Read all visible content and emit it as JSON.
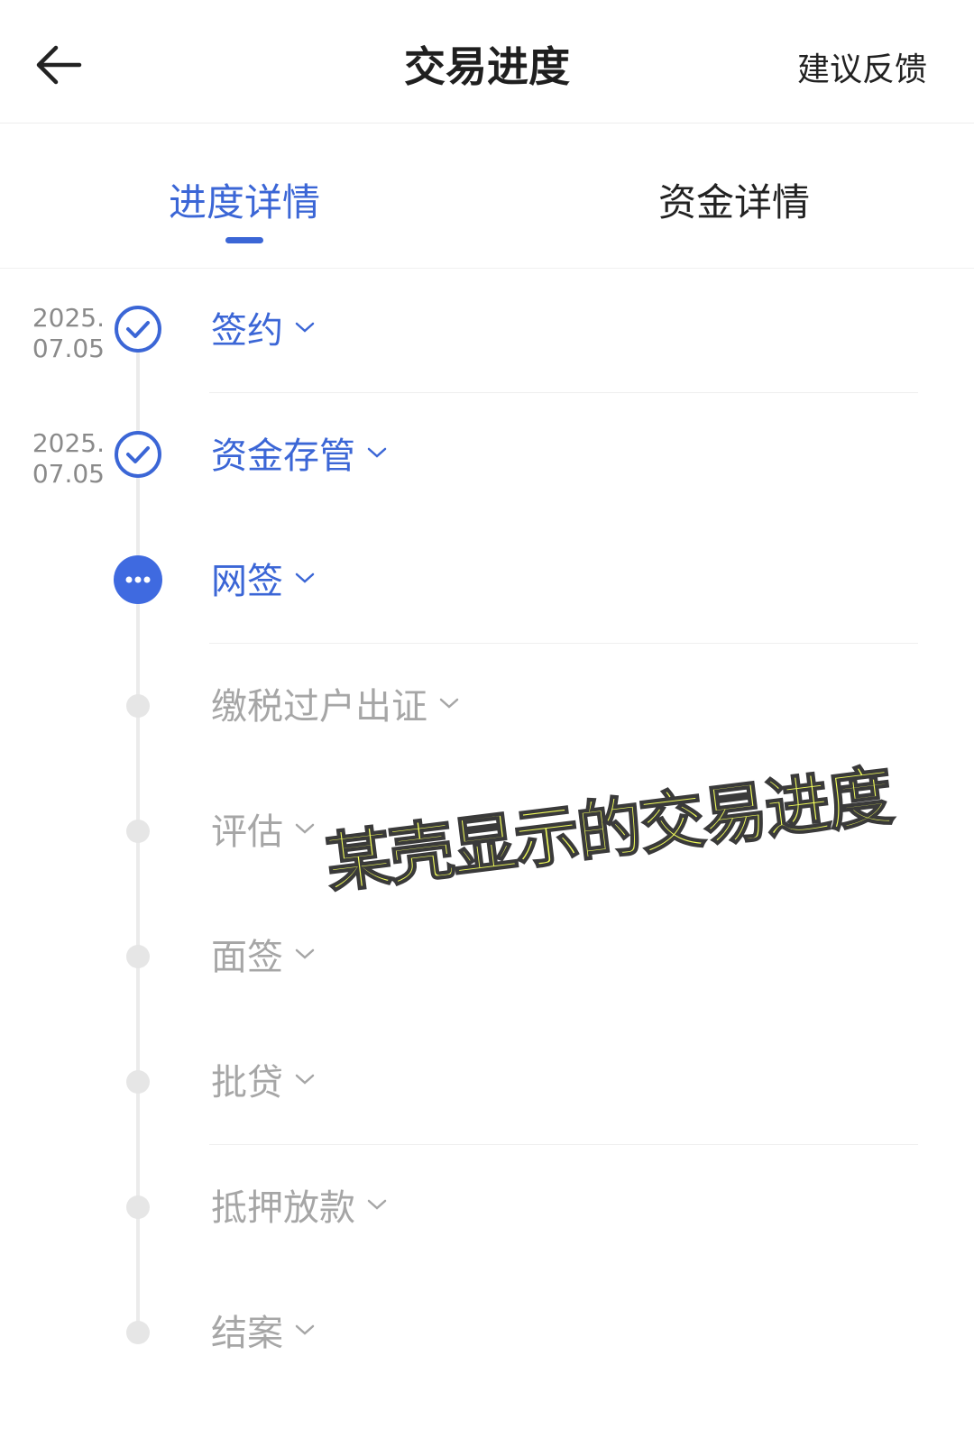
{
  "header": {
    "title": "交易进度",
    "feedback": "建议反馈"
  },
  "tabs": [
    {
      "label": "进度详情",
      "active": true
    },
    {
      "label": "资金详情",
      "active": false
    }
  ],
  "steps": [
    {
      "label": "签约",
      "date_year": "2025.",
      "date_md": "07.05",
      "status": "done"
    },
    {
      "label": "资金存管",
      "date_year": "2025.",
      "date_md": "07.05",
      "status": "done"
    },
    {
      "label": "网签",
      "status": "active"
    },
    {
      "label": "缴税过户出证",
      "status": "todo"
    },
    {
      "label": "评估",
      "status": "todo"
    },
    {
      "label": "面签",
      "status": "todo"
    },
    {
      "label": "批贷",
      "status": "todo"
    },
    {
      "label": "抵押放款",
      "status": "todo"
    },
    {
      "label": "结案",
      "status": "todo"
    }
  ],
  "overlay_text": "某壳显示的交易进度",
  "colors": {
    "accent": "#3b66d6",
    "inactive": "#a6a6a6"
  }
}
